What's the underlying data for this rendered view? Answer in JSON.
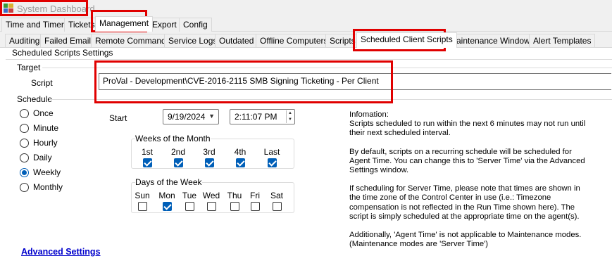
{
  "window": {
    "title": "System Dashboard"
  },
  "main_tabs": [
    {
      "label": "Time and Timers"
    },
    {
      "label": "Tickets"
    },
    {
      "label": "Management"
    },
    {
      "label": "Export"
    },
    {
      "label": "Config"
    }
  ],
  "sub_tabs": [
    {
      "label": "Auditing"
    },
    {
      "label": "Failed Emails"
    },
    {
      "label": "Remote Commands"
    },
    {
      "label": "Service Logs"
    },
    {
      "label": "Outdated"
    },
    {
      "label": "Offline Computers"
    },
    {
      "label": "Scripts"
    },
    {
      "label": "Scheduled Client Scripts"
    },
    {
      "label": "Maintenance Windows"
    },
    {
      "label": "Alert Templates"
    }
  ],
  "settings": {
    "title": "Scheduled Scripts Settings",
    "target": {
      "title": "Target",
      "script_label": "Script",
      "script_value": "ProVal - Development\\CVE-2016-2115 SMB Signing Ticketing - Per Client"
    },
    "schedule": {
      "title": "Schedule",
      "options": [
        {
          "label": "Once",
          "checked": false
        },
        {
          "label": "Minute",
          "checked": false
        },
        {
          "label": "Hourly",
          "checked": false
        },
        {
          "label": "Daily",
          "checked": false
        },
        {
          "label": "Weekly",
          "checked": true
        },
        {
          "label": "Monthly",
          "checked": false
        }
      ],
      "start_label": "Start",
      "start_date": "9/19/2024",
      "start_time": "2:11:07 PM",
      "weeks_of_month": {
        "title": "Weeks of the Month",
        "items": [
          {
            "label": "1st",
            "checked": true
          },
          {
            "label": "2nd",
            "checked": true
          },
          {
            "label": "3rd",
            "checked": true
          },
          {
            "label": "4th",
            "checked": true
          },
          {
            "label": "Last",
            "checked": true
          }
        ]
      },
      "days_of_week": {
        "title": "Days of the Week",
        "items": [
          {
            "label": "Sun",
            "checked": false
          },
          {
            "label": "Mon",
            "checked": true
          },
          {
            "label": "Tue",
            "checked": false
          },
          {
            "label": "Wed",
            "checked": false
          },
          {
            "label": "Thu",
            "checked": false
          },
          {
            "label": "Fri",
            "checked": false
          },
          {
            "label": "Sat",
            "checked": false
          }
        ]
      }
    },
    "info": {
      "heading": "Infomation:",
      "p1": "Scripts scheduled to run within the next 6 minutes may not run until their next scheduled interval.",
      "p2": "By default, scripts on a recurring schedule will be scheduled for Agent Time. You can change this to 'Server Time' via the Advanced Settings window.",
      "p3": "If scheduling for Server Time, please note that times are shown in the time zone of the Control Center in use (i.e.: Timezone compensation is not reflected in the Run Time shown here). The script is simply scheduled at the appropriate time on the agent(s).",
      "p4": "Additionally, 'Agent Time' is not applicable to Maintenance modes. (Maintenance modes are 'Server Time')"
    },
    "advanced_link": "Advanced Settings"
  },
  "colors": {
    "accent": "#005fb8",
    "highlight": "#e00000",
    "link": "#0000cc"
  },
  "icons": {
    "app": "dashboard-app-icon"
  }
}
